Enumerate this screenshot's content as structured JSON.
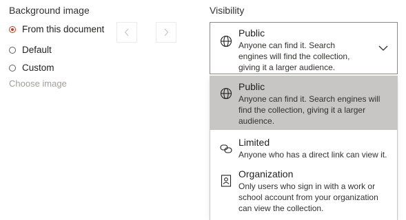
{
  "background": {
    "title": "Background image",
    "options": [
      {
        "label": "From this document",
        "checked": true
      },
      {
        "label": "Default",
        "checked": false
      },
      {
        "label": "Custom",
        "checked": false
      }
    ],
    "choose_image": "Choose image"
  },
  "visibility": {
    "title": "Visibility",
    "selected": {
      "title": "Public",
      "desc": "Anyone can find it. Search engines will find the collection, giving it a larger audience.",
      "icon": "globe-icon"
    },
    "options": [
      {
        "title": "Public",
        "desc": "Anyone can find it. Search engines will find the collection, giving it a larger audience.",
        "icon": "globe-icon",
        "highlighted": true
      },
      {
        "title": "Limited",
        "desc": "Anyone who has a direct link can view it.",
        "icon": "link-icon",
        "highlighted": false
      },
      {
        "title": "Organization",
        "desc": "Only users who sign in with a work or school account from your organization can view the collection.",
        "icon": "contact-card-icon",
        "highlighted": false
      }
    ]
  },
  "colors": {
    "accent": "#c43e1c",
    "highlight": "#c8c6c4"
  }
}
